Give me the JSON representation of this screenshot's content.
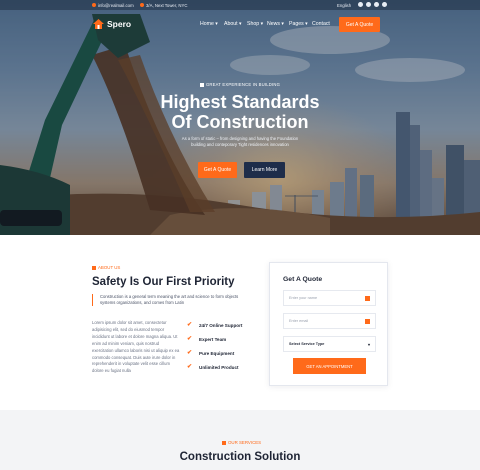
{
  "topbar": {
    "email": "info@realmail.com",
    "address": "3/A, Next Tower, NYC",
    "language": "English"
  },
  "brand": {
    "name": "Spero",
    "accent_color": "#ff6a1a",
    "dark_color": "#1e2d4a"
  },
  "nav": {
    "items": [
      {
        "label": "Home"
      },
      {
        "label": "About"
      },
      {
        "label": "Shop"
      },
      {
        "label": "News"
      },
      {
        "label": "Pages"
      },
      {
        "label": "Contact"
      }
    ],
    "cta_label": "Get A Quote"
  },
  "hero": {
    "tag": "GREAT EXPERIENCE IN BUILDING",
    "title_line1": "Highest Standards",
    "title_line2": "Of Construction",
    "description": "As a form of static – from designing and having the Foundation building and conteporary Tight residences innovation",
    "primary_button": "Get A Quote",
    "secondary_button": "Learn More"
  },
  "about": {
    "tag": "ABOUT US",
    "title": "Safety Is Our First Priority",
    "lead": "Construction is a general term meaning the art and science to form objects systems organizations, and comes from Latin",
    "body": "Lorem ipsum dolor sit amet, consectetur adipisicing elit, sed do eiusmod tempor incididunt ut labore et dolore magna aliqua. Ut enim ad minim veniam, quis nostrud exercitation ullamco laboris nisi ut aliquip ex ea commodo consequat. Duis aute irure dolor in reprehenderit in voluptate velit esse cillum dolore eu fugiat nulla",
    "features": [
      {
        "label": "24/7 Online Support"
      },
      {
        "label": "Expert Team"
      },
      {
        "label": "Pure Equipment"
      },
      {
        "label": "Unlimited Product"
      }
    ]
  },
  "quote_form": {
    "title": "Get A Quote",
    "name_placeholder": "Enter your name",
    "email_placeholder": "Enter email",
    "service_select": "Select Service Type",
    "submit_label": "GET AN APPOINTMENT"
  },
  "services": {
    "tag": "OUR SERVICES",
    "title": "Construction Solution"
  }
}
